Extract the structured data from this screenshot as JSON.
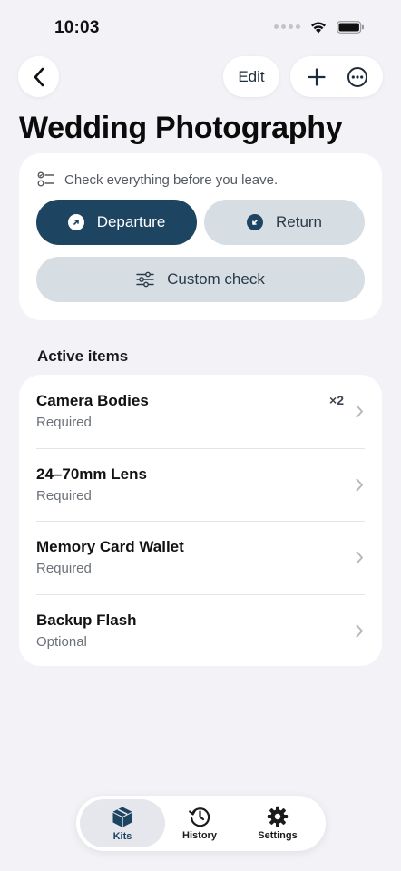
{
  "status": {
    "time": "10:03"
  },
  "nav": {
    "edit_label": "Edit"
  },
  "page": {
    "title": "Wedding Photography"
  },
  "check": {
    "hint": "Check everything before you leave.",
    "departure_label": "Departure",
    "return_label": "Return",
    "custom_label": "Custom check"
  },
  "section": {
    "active_title": "Active items"
  },
  "items": [
    {
      "name": "Camera Bodies",
      "status": "Required",
      "qty": "×2"
    },
    {
      "name": "24–70mm Lens",
      "status": "Required",
      "qty": ""
    },
    {
      "name": "Memory Card Wallet",
      "status": "Required",
      "qty": ""
    },
    {
      "name": "Backup Flash",
      "status": "Optional",
      "qty": ""
    }
  ],
  "tabs": [
    {
      "label": "Kits",
      "icon": "box-icon",
      "selected": true
    },
    {
      "label": "History",
      "icon": "clock-history-icon",
      "selected": false
    },
    {
      "label": "Settings",
      "icon": "gear-icon",
      "selected": false
    }
  ],
  "colors": {
    "accent": "#1d4461",
    "secondary_pill": "#d6dde3",
    "background": "#f2f2f7"
  }
}
